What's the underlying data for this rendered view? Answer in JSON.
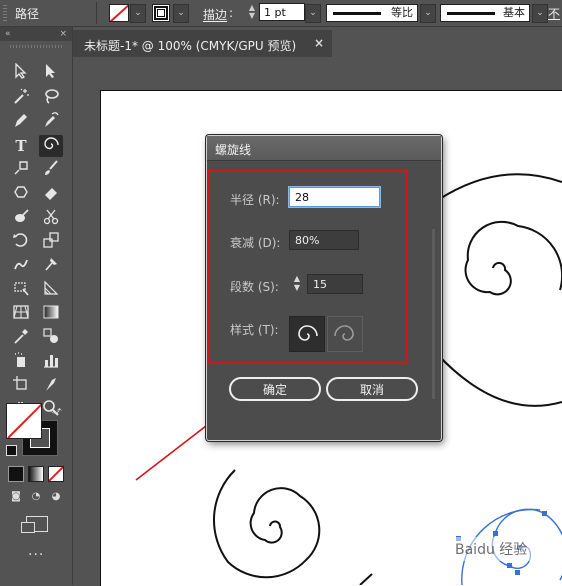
{
  "toolbar": {
    "title": "路径",
    "stroke_label": "描边",
    "stroke_colon": ":",
    "stroke_weight": "1 pt",
    "profile_label": "等比",
    "brush_label": "基本",
    "opacity_label": "不"
  },
  "tools_panel": {
    "collapse": "«",
    "close": "×"
  },
  "document_tab": {
    "title": "未标题-1* @ 100% (CMYK/GPU 预览)",
    "close": "×"
  },
  "spiral_dialog": {
    "title": "螺旋线",
    "radius_label": "半径 (R):",
    "radius_value": "28",
    "decay_label": "衰减 (D):",
    "decay_value": "80%",
    "segments_label": "段数 (S):",
    "segments_value": "15",
    "style_label": "样式 (T):",
    "style_options": [
      "counterclockwise-spiral",
      "clockwise-spiral"
    ],
    "style_selected": "counterclockwise-spiral",
    "ok_label": "确定",
    "cancel_label": "取消"
  },
  "annotation": {
    "highlight_color": "#d4141a",
    "arrow_color": "#d4141a"
  },
  "watermark": {
    "text": "Baidu 经验"
  },
  "colors": {
    "selection_blue": "#3a6fd8",
    "panel_bg": "#535353"
  },
  "more_tools": "···"
}
